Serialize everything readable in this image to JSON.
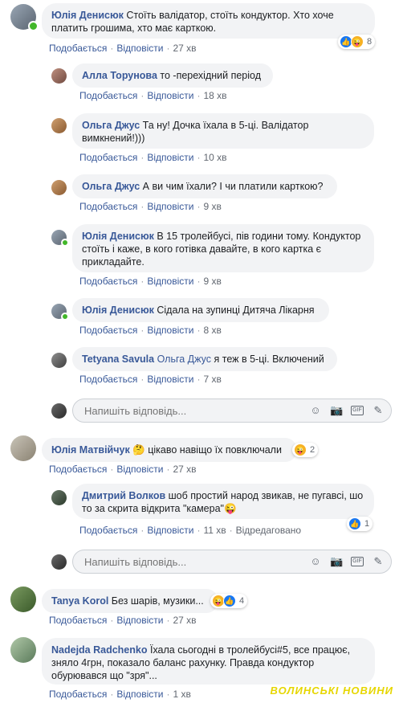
{
  "colors": {
    "link": "#385898",
    "bubble": "#f2f3f5",
    "meta": "#616770",
    "online": "#42b72a"
  },
  "labels": {
    "like": "Подобається",
    "reply": "Відповісти",
    "edited": "Відредаговано",
    "reply_placeholder": "Напишіть відповідь..."
  },
  "comments": [
    {
      "author": "Юлія Денисюк",
      "text": "Стоїть валідатор, стоїть кондуктор. Хто хоче платить грошима, хто має карткою.",
      "time": "27 хв",
      "reactions": "8",
      "online": true
    },
    {
      "author": "Алла Торунова",
      "text": "то -перехідний період",
      "time": "18 хв"
    },
    {
      "author": "Ольга Джус",
      "text": "Та ну! Дочка їхала в 5-ці. Валідатор вимкнений!)))",
      "time": "10 хв"
    },
    {
      "author": "Ольга Джус",
      "text": "А ви чим їхали? І чи платили карткою?",
      "time": "9 хв"
    },
    {
      "author": "Юлія Денисюк",
      "text": "В 15 тролейбусі, пів години тому. Кондуктор стоїть і каже, в кого готівка давайте, в кого картка є прикладайте.",
      "time": "9 хв",
      "online": true
    },
    {
      "author": "Юлія Денисюк",
      "text": "Сідала на зупинці Дитяча Лікарня",
      "time": "8 хв",
      "online": true
    },
    {
      "author": "Tetyana Savula",
      "mention": "Ольга Джус",
      "text": "я теж в 5-ці. Включений",
      "time": "7 хв"
    },
    {
      "author": "Юлія Матвійчук",
      "text": "🤔 цікаво навіщо їх повключали",
      "time": "27 хв",
      "reactions": "2"
    },
    {
      "author": "Дмитрий Волков",
      "text": "шоб простий народ звикав, не пугавсі, шо то за скрита відкрита \"камера\"😜",
      "time": "11 хв",
      "reactions": "1"
    },
    {
      "author": "Tanya Korol",
      "text": "Без шарів, музики...",
      "time": "27 хв",
      "reactions": "4"
    },
    {
      "author": "Nadejda Radchenko",
      "text": "Їхала сьогодні в тролейбусі#5, все працює, зняло 4грн, показало баланс рахунку. Правда кондуктор обурювався що \"зря\"...",
      "time": "1 хв"
    }
  ],
  "watermark": "ВОЛИНСЬКІ НОВИНИ"
}
